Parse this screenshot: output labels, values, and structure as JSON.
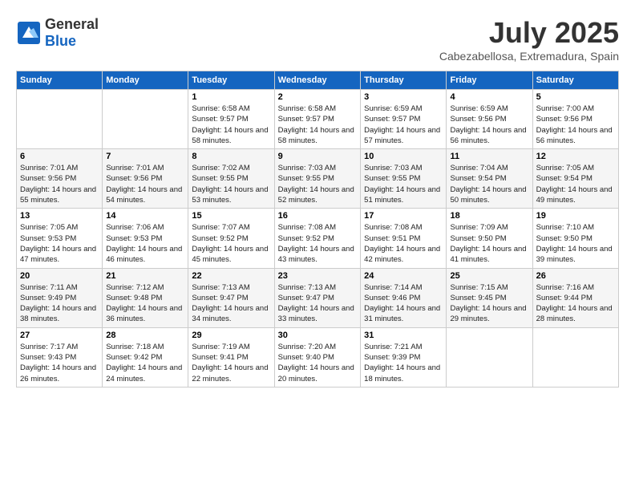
{
  "header": {
    "logo_general": "General",
    "logo_blue": "Blue",
    "month": "July 2025",
    "location": "Cabezabellosa, Extremadura, Spain"
  },
  "days_of_week": [
    "Sunday",
    "Monday",
    "Tuesday",
    "Wednesday",
    "Thursday",
    "Friday",
    "Saturday"
  ],
  "weeks": [
    [
      {
        "day": "",
        "info": ""
      },
      {
        "day": "",
        "info": ""
      },
      {
        "day": "1",
        "info": "Sunrise: 6:58 AM\nSunset: 9:57 PM\nDaylight: 14 hours and 58 minutes."
      },
      {
        "day": "2",
        "info": "Sunrise: 6:58 AM\nSunset: 9:57 PM\nDaylight: 14 hours and 58 minutes."
      },
      {
        "day": "3",
        "info": "Sunrise: 6:59 AM\nSunset: 9:57 PM\nDaylight: 14 hours and 57 minutes."
      },
      {
        "day": "4",
        "info": "Sunrise: 6:59 AM\nSunset: 9:56 PM\nDaylight: 14 hours and 56 minutes."
      },
      {
        "day": "5",
        "info": "Sunrise: 7:00 AM\nSunset: 9:56 PM\nDaylight: 14 hours and 56 minutes."
      }
    ],
    [
      {
        "day": "6",
        "info": "Sunrise: 7:01 AM\nSunset: 9:56 PM\nDaylight: 14 hours and 55 minutes."
      },
      {
        "day": "7",
        "info": "Sunrise: 7:01 AM\nSunset: 9:56 PM\nDaylight: 14 hours and 54 minutes."
      },
      {
        "day": "8",
        "info": "Sunrise: 7:02 AM\nSunset: 9:55 PM\nDaylight: 14 hours and 53 minutes."
      },
      {
        "day": "9",
        "info": "Sunrise: 7:03 AM\nSunset: 9:55 PM\nDaylight: 14 hours and 52 minutes."
      },
      {
        "day": "10",
        "info": "Sunrise: 7:03 AM\nSunset: 9:55 PM\nDaylight: 14 hours and 51 minutes."
      },
      {
        "day": "11",
        "info": "Sunrise: 7:04 AM\nSunset: 9:54 PM\nDaylight: 14 hours and 50 minutes."
      },
      {
        "day": "12",
        "info": "Sunrise: 7:05 AM\nSunset: 9:54 PM\nDaylight: 14 hours and 49 minutes."
      }
    ],
    [
      {
        "day": "13",
        "info": "Sunrise: 7:05 AM\nSunset: 9:53 PM\nDaylight: 14 hours and 47 minutes."
      },
      {
        "day": "14",
        "info": "Sunrise: 7:06 AM\nSunset: 9:53 PM\nDaylight: 14 hours and 46 minutes."
      },
      {
        "day": "15",
        "info": "Sunrise: 7:07 AM\nSunset: 9:52 PM\nDaylight: 14 hours and 45 minutes."
      },
      {
        "day": "16",
        "info": "Sunrise: 7:08 AM\nSunset: 9:52 PM\nDaylight: 14 hours and 43 minutes."
      },
      {
        "day": "17",
        "info": "Sunrise: 7:08 AM\nSunset: 9:51 PM\nDaylight: 14 hours and 42 minutes."
      },
      {
        "day": "18",
        "info": "Sunrise: 7:09 AM\nSunset: 9:50 PM\nDaylight: 14 hours and 41 minutes."
      },
      {
        "day": "19",
        "info": "Sunrise: 7:10 AM\nSunset: 9:50 PM\nDaylight: 14 hours and 39 minutes."
      }
    ],
    [
      {
        "day": "20",
        "info": "Sunrise: 7:11 AM\nSunset: 9:49 PM\nDaylight: 14 hours and 38 minutes."
      },
      {
        "day": "21",
        "info": "Sunrise: 7:12 AM\nSunset: 9:48 PM\nDaylight: 14 hours and 36 minutes."
      },
      {
        "day": "22",
        "info": "Sunrise: 7:13 AM\nSunset: 9:47 PM\nDaylight: 14 hours and 34 minutes."
      },
      {
        "day": "23",
        "info": "Sunrise: 7:13 AM\nSunset: 9:47 PM\nDaylight: 14 hours and 33 minutes."
      },
      {
        "day": "24",
        "info": "Sunrise: 7:14 AM\nSunset: 9:46 PM\nDaylight: 14 hours and 31 minutes."
      },
      {
        "day": "25",
        "info": "Sunrise: 7:15 AM\nSunset: 9:45 PM\nDaylight: 14 hours and 29 minutes."
      },
      {
        "day": "26",
        "info": "Sunrise: 7:16 AM\nSunset: 9:44 PM\nDaylight: 14 hours and 28 minutes."
      }
    ],
    [
      {
        "day": "27",
        "info": "Sunrise: 7:17 AM\nSunset: 9:43 PM\nDaylight: 14 hours and 26 minutes."
      },
      {
        "day": "28",
        "info": "Sunrise: 7:18 AM\nSunset: 9:42 PM\nDaylight: 14 hours and 24 minutes."
      },
      {
        "day": "29",
        "info": "Sunrise: 7:19 AM\nSunset: 9:41 PM\nDaylight: 14 hours and 22 minutes."
      },
      {
        "day": "30",
        "info": "Sunrise: 7:20 AM\nSunset: 9:40 PM\nDaylight: 14 hours and 20 minutes."
      },
      {
        "day": "31",
        "info": "Sunrise: 7:21 AM\nSunset: 9:39 PM\nDaylight: 14 hours and 18 minutes."
      },
      {
        "day": "",
        "info": ""
      },
      {
        "day": "",
        "info": ""
      }
    ]
  ]
}
